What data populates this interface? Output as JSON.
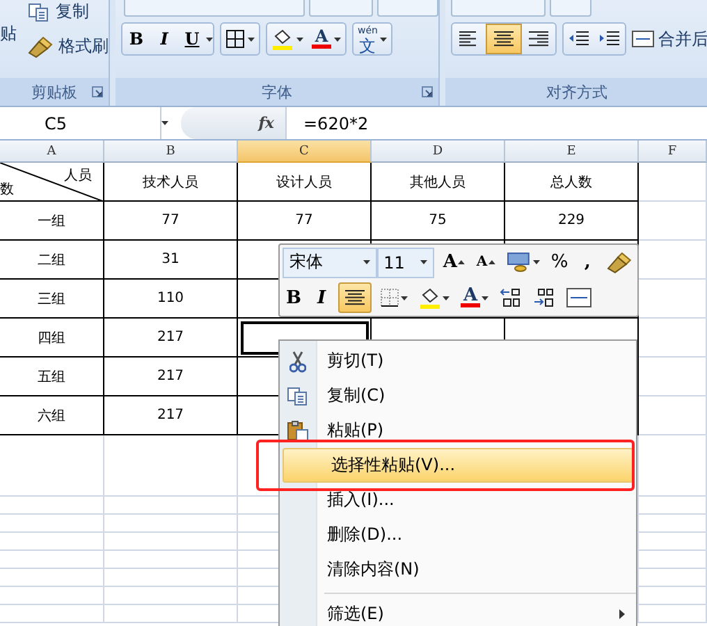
{
  "ribbon": {
    "paste_label": "贴",
    "clipboard_items": [
      {
        "kind": "copy",
        "label": "复制"
      },
      {
        "kind": "format-painter",
        "label": "格式刷"
      }
    ],
    "font_buttons": {
      "bold": "B",
      "italic": "I",
      "underline": "U",
      "font_color": "A",
      "phonetic_ruby": "wén",
      "phonetic_char": "文"
    },
    "alignment": [
      {
        "kind": "left",
        "selected": false
      },
      {
        "kind": "center",
        "selected": true
      },
      {
        "kind": "right",
        "selected": false
      }
    ],
    "merge_label": "合并后",
    "groups": [
      {
        "label": "剪贴板"
      },
      {
        "label": "字体"
      },
      {
        "label": "对齐方式"
      }
    ]
  },
  "formula_bar": {
    "name_box": "C5",
    "fx": "fx",
    "formula": "=620*2"
  },
  "sheet": {
    "columns": [
      {
        "label": "A",
        "selected": false
      },
      {
        "label": "B",
        "selected": false
      },
      {
        "label": "C",
        "selected": true
      },
      {
        "label": "D",
        "selected": false
      },
      {
        "label": "E",
        "selected": false
      },
      {
        "label": "F",
        "selected": false
      }
    ],
    "header": {
      "corner_top": "人员",
      "corner_bottom": "数",
      "cells": [
        "技术人员",
        "设计人员",
        "其他人员",
        "总人数"
      ]
    },
    "rows": [
      {
        "cells": [
          {
            "text": "一组",
            "selected": false
          },
          {
            "text": "77",
            "selected": false
          },
          {
            "text": "77",
            "selected": false
          },
          {
            "text": "75",
            "selected": false
          },
          {
            "text": "229",
            "selected": false
          }
        ]
      },
      {
        "cells": [
          {
            "text": "二组",
            "selected": false
          },
          {
            "text": "31",
            "selected": false
          }
        ]
      },
      {
        "cells": [
          {
            "text": "三组",
            "selected": false
          },
          {
            "text": "110",
            "selected": false
          }
        ]
      },
      {
        "cells": [
          {
            "text": "四组",
            "selected": false
          },
          {
            "text": "217",
            "selected": false
          },
          {
            "selected": true
          }
        ]
      },
      {
        "cells": [
          {
            "text": "五组",
            "selected": false
          },
          {
            "text": "217",
            "selected": false
          }
        ]
      },
      {
        "cells": [
          {
            "text": "六组",
            "selected": false
          },
          {
            "text": "217",
            "selected": false
          }
        ]
      }
    ]
  },
  "mini_toolbar": {
    "font": "宋体",
    "size": "11",
    "grow": "A",
    "shrink": "A",
    "percent": "%",
    "comma": ",",
    "bold": "B",
    "italic": "I",
    "center_selected": true,
    "font_color": "A"
  },
  "context_menu": {
    "items": [
      {
        "kind": "cut",
        "label": "剪切(T)",
        "selected": false,
        "separator_before": false,
        "submenu": false
      },
      {
        "kind": "copy",
        "label": "复制(C)",
        "selected": false,
        "separator_before": false,
        "submenu": false
      },
      {
        "kind": "paste",
        "label": "粘贴(P)",
        "selected": false,
        "separator_before": false,
        "submenu": false
      },
      {
        "kind": "plain",
        "label": "选择性粘贴(V)...",
        "selected": true,
        "separator_before": false,
        "submenu": false
      },
      {
        "kind": "plain",
        "label": "插入(I)...",
        "selected": false,
        "separator_before": false,
        "submenu": false
      },
      {
        "kind": "plain",
        "label": "删除(D)...",
        "selected": false,
        "separator_before": false,
        "submenu": false
      },
      {
        "kind": "plain",
        "label": "清除内容(N)",
        "selected": false,
        "separator_before": false,
        "submenu": false
      },
      {
        "kind": "plain",
        "label": "筛选(E)",
        "selected": false,
        "separator_before": true,
        "submenu": true
      }
    ]
  },
  "annotation": {
    "kind": "highlight-box"
  }
}
